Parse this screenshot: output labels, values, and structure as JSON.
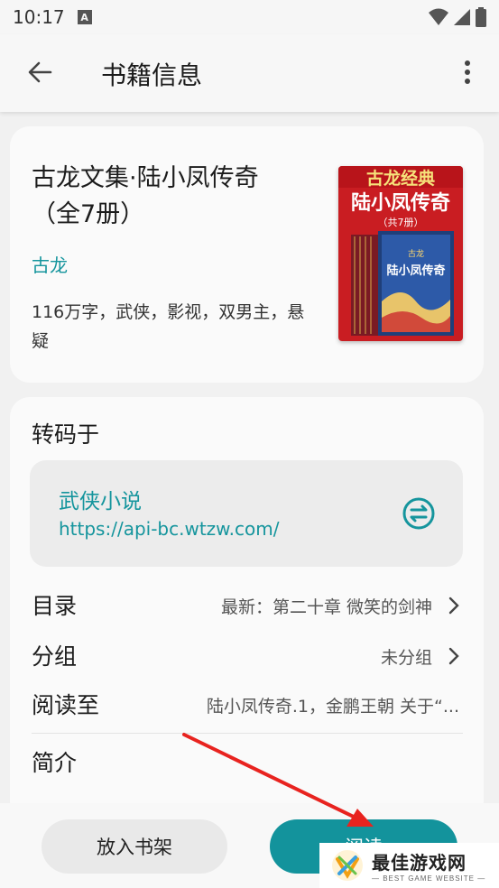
{
  "status_bar": {
    "time": "10:17",
    "notification": "A"
  },
  "app_bar": {
    "title": "书籍信息"
  },
  "book": {
    "title": "古龙文集·陆小凤传奇（全7册）",
    "author": "古龙",
    "tags": "116万字，武侠，影视，双男主，悬疑",
    "cover": {
      "top_text": "古龙经典",
      "main_title": "陆小凤传奇",
      "volumes": "（共7册）",
      "box_author": "古龙",
      "box_title": "陆小凤传奇"
    }
  },
  "source": {
    "heading": "转码于",
    "name": "武侠小说",
    "url": "https://api-bc.wtzw.com/"
  },
  "rows": {
    "toc_label": "目录",
    "toc_value": "最新：第二十章 微笑的剑神",
    "group_label": "分组",
    "group_value": "未分组",
    "progress_label": "阅读至",
    "progress_value": "陆小凤传奇.1，金鹏王朝 关于“..."
  },
  "intro": {
    "heading": "简介"
  },
  "actions": {
    "shelf_label": "放入书架",
    "read_label": "阅读"
  },
  "watermark": {
    "main": "最佳游戏网",
    "sub": "— BEST GAME WEBSITE —"
  },
  "colors": {
    "accent": "#13939c",
    "link": "#15959d",
    "arrow": "#e8231f"
  }
}
